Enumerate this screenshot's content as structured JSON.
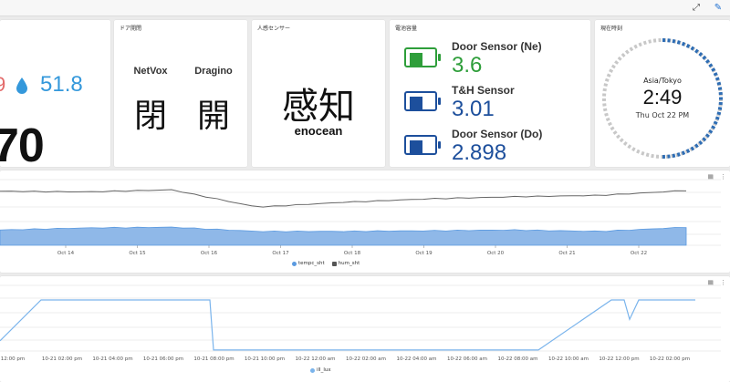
{
  "toolbar": {
    "expand_icon": "expand-icon",
    "edit_icon": "pencil-icon"
  },
  "panel_temp": {
    "value_partial": "9",
    "humidity": "51.8",
    "main": "70"
  },
  "panel_door": {
    "title": "ドア開閉",
    "devices": [
      {
        "name": "NetVox",
        "state": "閉"
      },
      {
        "name": "Dragino",
        "state": "開"
      }
    ]
  },
  "panel_motion": {
    "title": "人感センサー",
    "state": "感知",
    "brand": "enocean"
  },
  "panel_battery": {
    "title": "電池容量",
    "items": [
      {
        "name": "Door Sensor (Ne)",
        "value": "3.6",
        "color": "#2e9e3a",
        "level": 0.4
      },
      {
        "name": "T&H Sensor",
        "value": "3.01",
        "color": "#1d4f9c",
        "level": 0.4
      },
      {
        "name": "Door Sensor (Do)",
        "value": "2.898",
        "color": "#1d4f9c",
        "level": 0.4
      }
    ]
  },
  "panel_clock": {
    "title": "現在時刻",
    "timezone": "Asia/Tokyo",
    "time": "2:49",
    "date": "Thu Oct 22 PM",
    "progress": 0.5
  },
  "colors": {
    "humidity_blue": "#3498db",
    "temp_red": "#e36a6a",
    "area_blue": "#8fb8e8",
    "line_grey": "#666666",
    "lux_line": "#7ab4ec"
  },
  "chart_data": [
    {
      "type": "area",
      "x": [
        "Oct 14",
        "Oct 15",
        "Oct 16",
        "Oct 17",
        "Oct 18",
        "Oct 19",
        "Oct 20",
        "Oct 21",
        "Oct 22"
      ],
      "series": [
        {
          "name": "tempc_sht",
          "type": "area",
          "values": [
            0.22,
            0.25,
            0.26,
            0.2,
            0.2,
            0.21,
            0.22,
            0.2,
            0.26
          ]
        },
        {
          "name": "hum_sht",
          "type": "line",
          "values": [
            0.78,
            0.77,
            0.8,
            0.55,
            0.62,
            0.67,
            0.7,
            0.72,
            0.79
          ]
        }
      ],
      "legend": "bottom-center",
      "grid": true
    },
    {
      "type": "line",
      "x": [
        "10-21 02:00 pm",
        "10-21 04:00 pm",
        "10-21 06:00 pm",
        "10-21 08:00 pm",
        "10-21 10:00 pm",
        "10-22 12:00 am",
        "10-22 02:00 am",
        "10-22 04:00 am",
        "10-22 06:00 am",
        "10-22 08:00 am",
        "10-22 10:00 am",
        "10-22 12:00 pm",
        "10-22 02:00 pm"
      ],
      "x_first_partial": "12:00 pm",
      "series": [
        {
          "name": "ill_lux",
          "values": [
            0.2,
            1.0,
            1.0,
            1.0,
            0.02,
            0.02,
            0.02,
            0.02,
            0.02,
            0.02,
            1.0,
            1.0,
            0.62,
            1.0,
            1.0
          ]
        }
      ],
      "legend": "bottom-center",
      "grid": true
    }
  ]
}
